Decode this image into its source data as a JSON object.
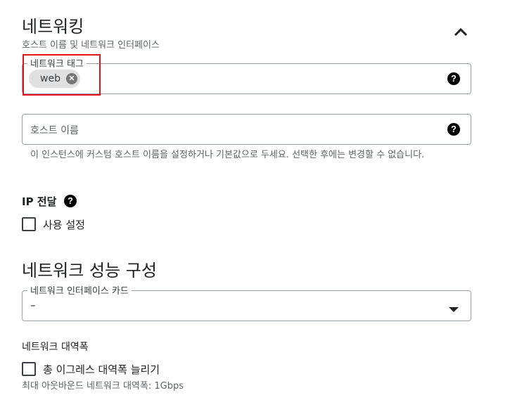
{
  "networking": {
    "title": "네트워킹",
    "subtitle": "호스트 이름 및 네트워크 인터페이스",
    "collapse_icon": "chevron-up-icon"
  },
  "network_tags": {
    "label": "네트워크 태그",
    "chips": [
      "web"
    ],
    "help_icon": "help-icon",
    "highlight_color": "#e8121b"
  },
  "hostname": {
    "placeholder": "호스트 이름",
    "help_icon": "help-icon",
    "hint": "이 인스턴스에 커스텀 호스트 이름을 설정하거나 기본값으로 두세요. 선택한 후에는 변경할 수 없습니다."
  },
  "ip_forwarding": {
    "label": "IP 전달",
    "checkbox_label": "사용 설정",
    "checked": false
  },
  "network_performance": {
    "title": "네트워크 성능 구성",
    "nic_label": "네트워크 인터페이스 카드",
    "nic_value": "–",
    "dropdown_icon": "caret-down-icon"
  },
  "bandwidth": {
    "label": "네트워크 대역폭",
    "checkbox_label": "총 이그레스 대역폭 늘리기",
    "checked": false,
    "max_text": "최대 아웃바운드 네트워크 대역폭: 1Gbps"
  }
}
